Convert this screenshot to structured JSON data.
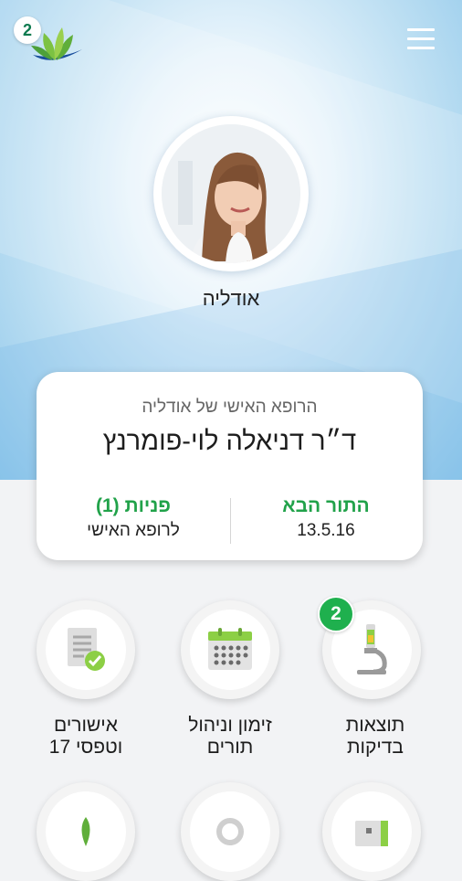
{
  "header": {
    "logo_badge": "2",
    "menu_icon": "hamburger-menu-icon"
  },
  "profile": {
    "name": "אודליה"
  },
  "doctor_card": {
    "subtitle": "הרופא האישי של אודליה",
    "doctor_name": "ד״ר דניאלה לוי-פומרנץ",
    "next_appointment_title": "התור הבא",
    "next_appointment_date": "13.5.16",
    "inquiries_title": "פניות (1)",
    "inquiries_sub": "לרופא האישי"
  },
  "tiles": [
    {
      "label_line1": "תוצאות",
      "label_line2": "בדיקות",
      "icon": "microscope-icon",
      "badge": "2"
    },
    {
      "label_line1": "זימון וניהול",
      "label_line2": "תורים",
      "icon": "calendar-icon"
    },
    {
      "label_line1": "אישורים",
      "label_line2": "וטפסי 17",
      "icon": "document-check-icon"
    }
  ],
  "colors": {
    "accent_green": "#21a24a",
    "badge_green": "#1fb04e",
    "sky_blue": "#8ec7ea"
  }
}
